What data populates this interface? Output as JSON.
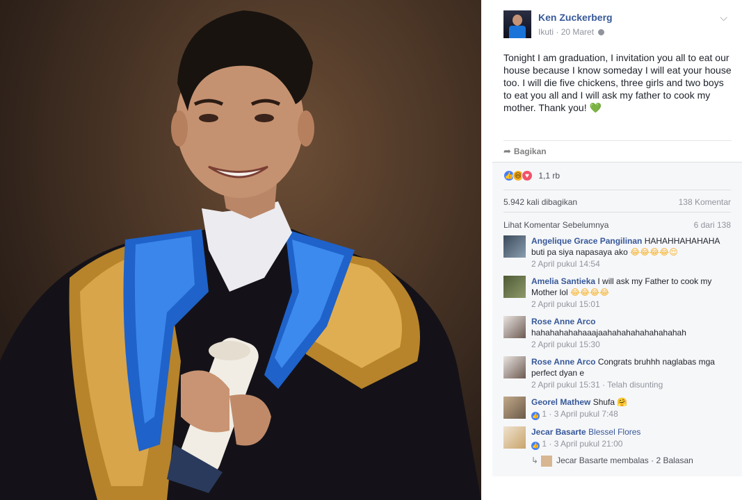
{
  "post": {
    "author": "Ken Zuckerberg",
    "follow": "Ikuti",
    "date": "20 Maret",
    "text": "Tonight I am graduation, I invitation you all to eat our house because I know someday I will eat your house too. I will die five chickens, three girls and two boys to eat you all and I will ask my father to cook my mother. Thank you!",
    "emoji": "💚",
    "share_label": "Bagikan"
  },
  "feedback": {
    "reaction_count": "1,1 rb",
    "shares": "5.942 kali dibagikan",
    "comments": "138 Komentar",
    "view_previous": "Lihat Komentar Sebelumnya",
    "pager": "6 dari 138"
  },
  "comments": [
    {
      "name": "Angelique Grace Pangilinan",
      "text": "HAHAHHAHAHAHA buti pa siya napasaya ako",
      "emojis": "😂😂😂😂😌",
      "time": "2 April pukul 14:54"
    },
    {
      "name": "Amelia Santieka",
      "text": "I will ask my Father to cook my Mother lol",
      "emojis": "😂😂😂😂",
      "time": "2 April pukul 15:01"
    },
    {
      "name": "Rose Anne Arco",
      "text": "hahahahahahaaajaahahahahahahahahah",
      "emojis": "",
      "time": "2 April pukul 15:30"
    },
    {
      "name": "Rose Anne Arco",
      "text": "Congrats bruhhh naglabas mga perfect dyan e",
      "emojis": "",
      "time": "2 April pukul 15:31 · Telah disunting"
    },
    {
      "name": "Georel Mathew",
      "text": "Shufa",
      "emojis": "🤗",
      "likes": "1",
      "time": "3 April pukul 7:48"
    },
    {
      "name": "Jecar Basarte",
      "text": "Blessel Flores",
      "emojis": "",
      "likes": "1",
      "time": "3 April pukul 21:00"
    }
  ],
  "reply": {
    "text": "Jecar Basarte membalas · 2 Balasan"
  },
  "icons": {
    "share": "share-arrow-icon",
    "globe": "globe-icon",
    "chevron": "chevron-down-icon",
    "reply": "reply-arrow-icon"
  },
  "colors": {
    "link": "#365899",
    "muted": "#90949c",
    "like": "#4080ff",
    "love": "#f25268",
    "haha": "#f7b125"
  }
}
